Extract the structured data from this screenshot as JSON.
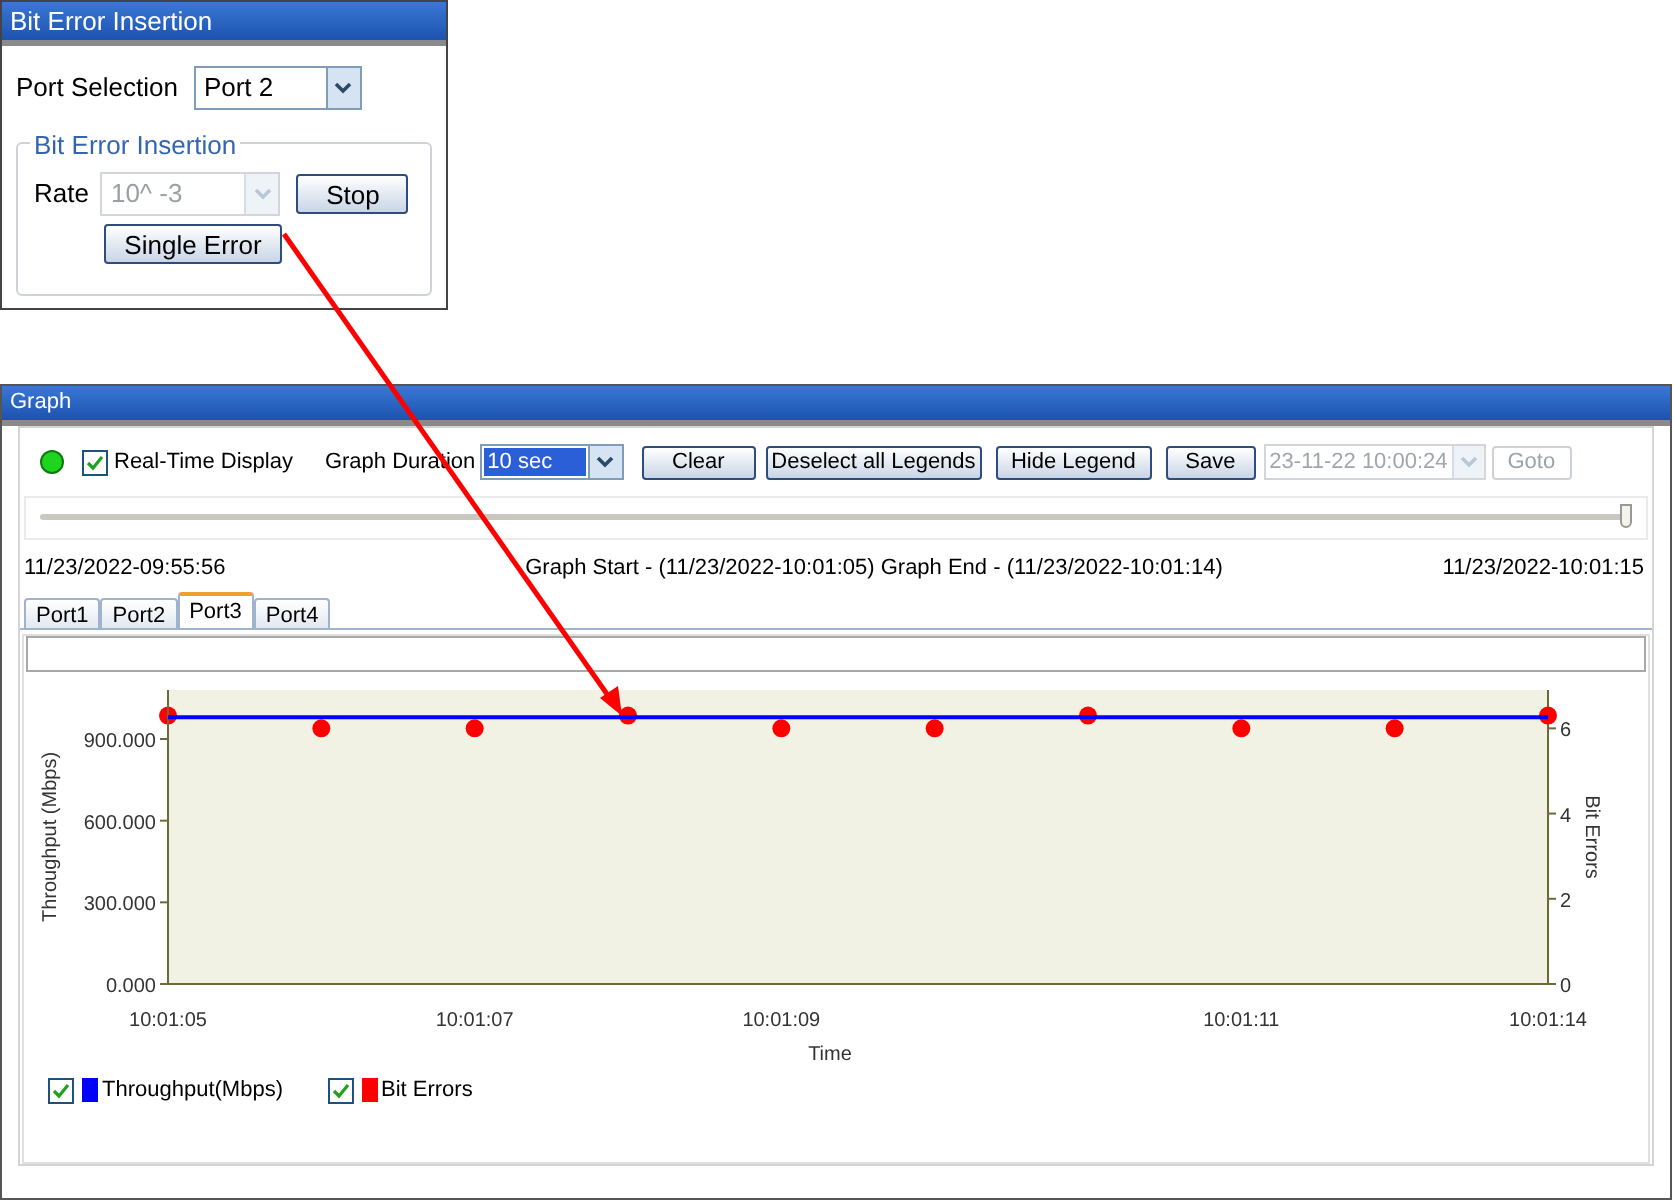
{
  "bit_error_panel": {
    "title": "Bit Error Insertion",
    "port_selection": {
      "label": "Port Selection",
      "value": "Port 2"
    },
    "group": {
      "title": "Bit Error Insertion",
      "rate": {
        "label": "Rate",
        "value": "10^ -3",
        "disabled": true
      },
      "buttons": [
        {
          "label": "Stop"
        },
        {
          "label": "Single Error"
        }
      ]
    }
  },
  "graph_window": {
    "title": "Graph",
    "indicator": {
      "on": true
    },
    "real_time": {
      "label": "Real-Time Display",
      "checked": true
    },
    "duration": {
      "label": "Graph Duration",
      "value": "10 sec"
    },
    "buttons": [
      {
        "label": "Clear"
      },
      {
        "label": "Deselect all Legends"
      },
      {
        "label": "Hide Legend"
      },
      {
        "label": "Save"
      }
    ],
    "goto_time": {
      "value": "23-11-22 10:00:24",
      "disabled": true
    },
    "goto_button": {
      "label": "Goto",
      "disabled": true
    },
    "timeline": {
      "level": 1
    },
    "first_time": "11/23/2022-09:55:56",
    "range": "Graph Start - (11/23/2022-10:01:05) Graph End - (11/23/2022-10:01:14)",
    "last_time": "11/23/2022-10:01:15",
    "tabs": [
      {
        "label": "Port1",
        "selected": false
      },
      {
        "label": "Port2",
        "selected": false
      },
      {
        "label": "Port3",
        "selected": true
      },
      {
        "label": "Port4",
        "selected": false
      }
    ],
    "chart_data": {
      "type": "line",
      "xlabel": "Time",
      "ylabel": "Throughput (Mbps)",
      "categories": [
        "10:01:05",
        null,
        "10:01:07",
        null,
        "10:01:09",
        null,
        null,
        "10:01:11",
        null,
        "10:01:14"
      ],
      "ylim": [
        0,
        1080
      ],
      "yticks": [
        {
          "value": 0,
          "label": "0.000"
        },
        {
          "value": 300,
          "label": "300.000"
        },
        {
          "value": 600,
          "label": "600.000"
        },
        {
          "value": 900,
          "label": "900.000"
        }
      ],
      "series": [
        {
          "name": "Throughput(Mbps)",
          "color": "#0000ff",
          "values": [
            980,
            980,
            980,
            980,
            980,
            980,
            980,
            980,
            980,
            980
          ]
        }
      ]
    },
    "bit_errors": {
      "chart_data": {
        "type": "scatter",
        "ylabel": "Bit Errors",
        "categories": [
          null,
          null,
          null,
          null,
          null,
          null,
          null,
          null,
          null,
          null
        ],
        "ylim": [
          0,
          6.9
        ],
        "yticks": [
          0,
          2,
          4,
          6
        ],
        "series": [
          {
            "name": "Bit Errors",
            "color": "#ff0000",
            "values": [
              6.3,
              6,
              6,
              6.3,
              6,
              6,
              6.3,
              6,
              6,
              6.3
            ]
          }
        ]
      }
    },
    "legend": [
      {
        "checked": true
      },
      {
        "checked": true
      }
    ]
  }
}
